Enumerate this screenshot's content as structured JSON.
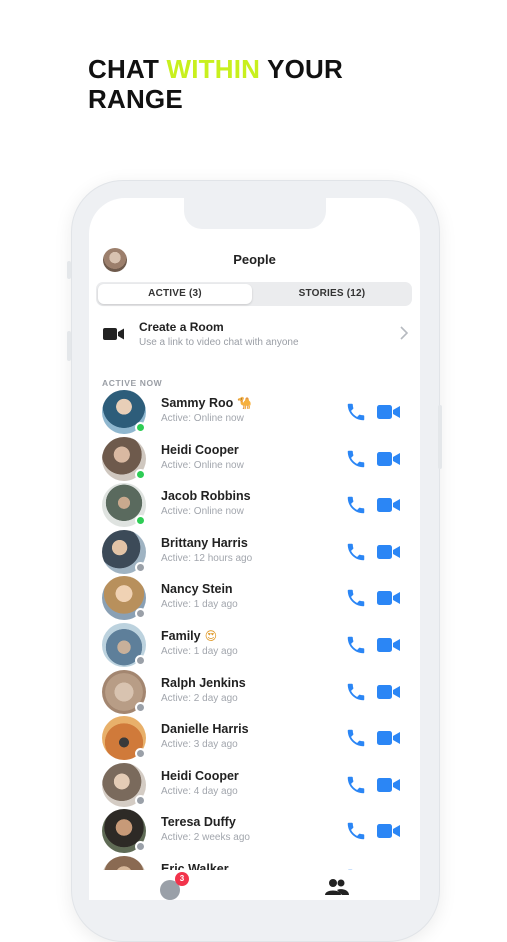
{
  "headline": {
    "part1": "CHAT ",
    "accent": "WITHIN",
    "part2": " YOUR",
    "line2": "RANGE"
  },
  "header": {
    "title": "People"
  },
  "tabs": {
    "active": "ACTIVE (3)",
    "stories": "STORIES (12)"
  },
  "room": {
    "title": "Create a Room",
    "subtitle": "Use a link to video chat with anyone"
  },
  "section_label": "ACTIVE NOW",
  "colors": {
    "accent": "#c8f01e",
    "online": "#2ecc55",
    "offline": "#9aa0a8",
    "action_blue": "#2b86f5",
    "badge": "#f2334b"
  },
  "contacts": [
    {
      "name": "Sammy Roo",
      "emoji": "🐪",
      "status": "Active: Online now",
      "online": true
    },
    {
      "name": "Heidi Cooper",
      "emoji": "",
      "status": "Active: Online now",
      "online": true
    },
    {
      "name": "Jacob Robbins",
      "emoji": "",
      "status": "Active: Online now",
      "online": true
    },
    {
      "name": "Brittany Harris",
      "emoji": "",
      "status": "Active: 12 hours ago",
      "online": false
    },
    {
      "name": "Nancy Stein",
      "emoji": "",
      "status": "Active: 1 day ago",
      "online": false
    },
    {
      "name": "Family",
      "emoji": "😍",
      "status": "Active: 1 day ago",
      "online": false
    },
    {
      "name": "Ralph Jenkins",
      "emoji": "",
      "status": "Active: 2 day ago",
      "online": false
    },
    {
      "name": "Danielle Harris",
      "emoji": "",
      "status": "Active: 3 day ago",
      "online": false
    },
    {
      "name": "Heidi Cooper",
      "emoji": "",
      "status": "Active: 4 day ago",
      "online": false
    },
    {
      "name": "Teresa Duffy",
      "emoji": "",
      "status": "Active: 2 weeks ago",
      "online": false
    },
    {
      "name": "Eric Walker",
      "emoji": "",
      "status": "",
      "online": false
    }
  ],
  "bottom_nav": {
    "chats_badge": "3"
  }
}
